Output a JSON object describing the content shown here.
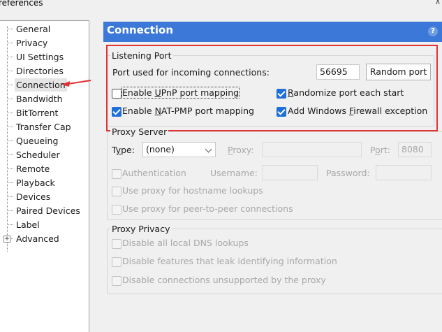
{
  "window": {
    "title": "references",
    "corner_glyph": "∧"
  },
  "sidebar": {
    "items": [
      {
        "label": "General"
      },
      {
        "label": "Privacy"
      },
      {
        "label": "UI Settings"
      },
      {
        "label": "Directories"
      },
      {
        "label": "Connection",
        "selected": true
      },
      {
        "label": "Bandwidth"
      },
      {
        "label": "BitTorrent"
      },
      {
        "label": "Transfer Cap"
      },
      {
        "label": "Queueing"
      },
      {
        "label": "Scheduler"
      },
      {
        "label": "Remote"
      },
      {
        "label": "Playback"
      },
      {
        "label": "Devices"
      },
      {
        "label": "Paired Devices"
      },
      {
        "label": "Label"
      },
      {
        "label": "Advanced",
        "expander": "+"
      }
    ]
  },
  "header": {
    "title": "Connection",
    "help_glyph": "?"
  },
  "listening_port": {
    "group_title": "Listening Port",
    "port_label": "Port used for incoming connections:",
    "port_value": "56695",
    "random_button": "Random port",
    "upnp": {
      "pre": "Enable ",
      "u": "U",
      "post": "PnP port mapping",
      "checked": false
    },
    "randomize": {
      "pre": "",
      "u": "R",
      "post": "andomize port each start",
      "checked": true
    },
    "natpmp": {
      "pre": "Enable ",
      "u": "N",
      "post": "AT-PMP port mapping",
      "checked": true
    },
    "firewall": {
      "pre": "Add Windows ",
      "u": "F",
      "post": "irewall exception",
      "checked": true
    }
  },
  "proxy_server": {
    "group_title": "Proxy Server",
    "type_label": {
      "pre": "T",
      "u": "y",
      "post": "pe:"
    },
    "type_value": "(none)",
    "proxy_label": {
      "pre": "",
      "u": "P",
      "post": "roxy:"
    },
    "port_label": {
      "pre": "P",
      "u": "o",
      "post": "rt:"
    },
    "port_value": "8080",
    "authentication": "Authentication",
    "username_label": "Username:",
    "password_label": "Password:",
    "hostname_lookups": "Use proxy for hostname lookups",
    "p2p": "Use proxy for peer-to-peer connections"
  },
  "proxy_privacy": {
    "group_title": "Proxy Privacy",
    "dns": "Disable all local DNS lookups",
    "leak": "Disable features that leak identifying information",
    "unsupported": "Disable connections unsupported by the proxy"
  },
  "colors": {
    "header": "#3b78d8",
    "highlight": "#e23232",
    "check": "#1e6fd9"
  }
}
